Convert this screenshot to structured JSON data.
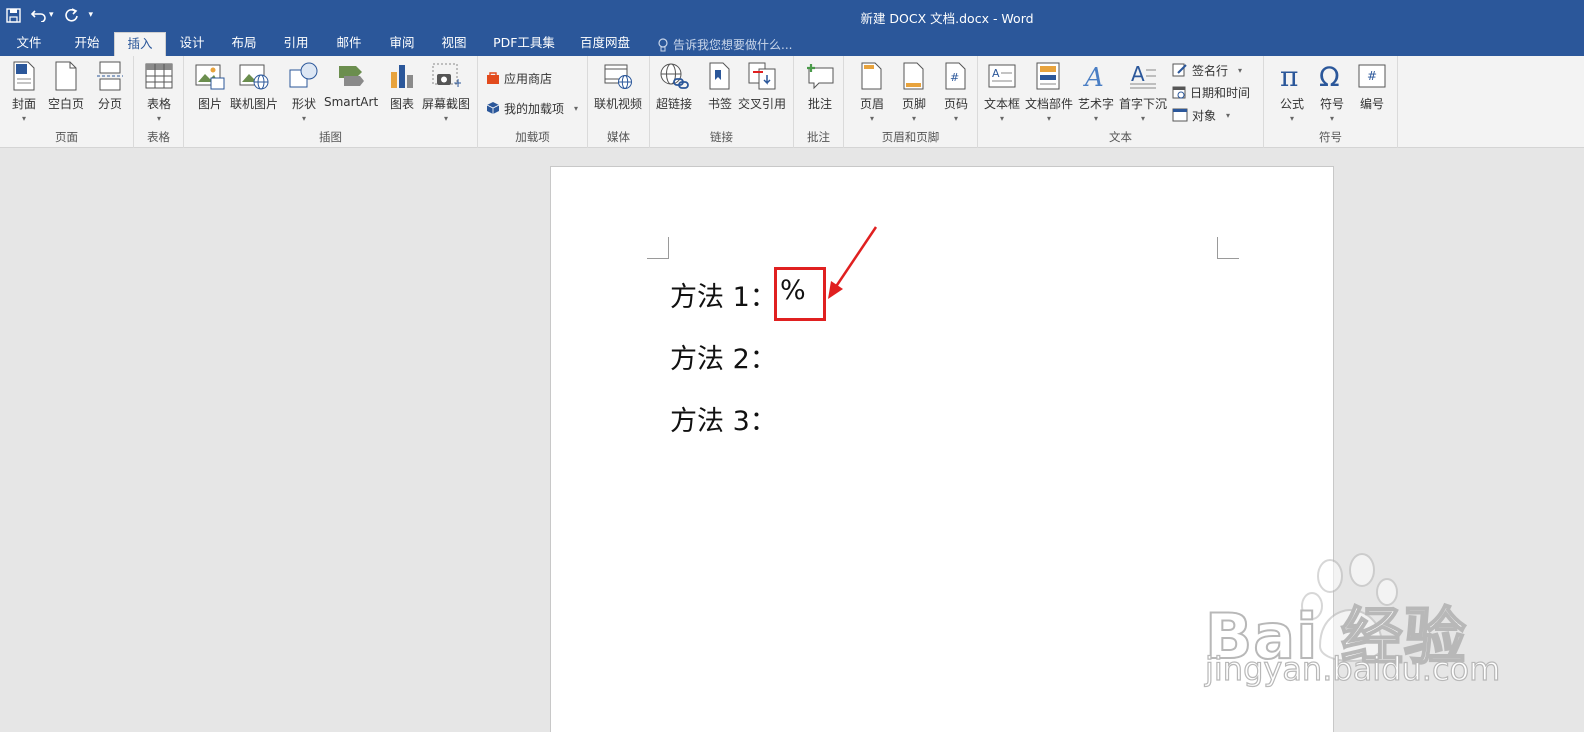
{
  "window": {
    "title": "新建 DOCX 文档.docx - Word"
  },
  "qat": {
    "undo_arrow": "▾",
    "customize": "▾"
  },
  "tabs": [
    {
      "label": "文件"
    },
    {
      "label": "开始"
    },
    {
      "label": "插入"
    },
    {
      "label": "设计"
    },
    {
      "label": "布局"
    },
    {
      "label": "引用"
    },
    {
      "label": "邮件"
    },
    {
      "label": "审阅"
    },
    {
      "label": "视图"
    },
    {
      "label": "PDF工具集"
    },
    {
      "label": "百度网盘"
    }
  ],
  "active_tab": "插入",
  "tellme": {
    "placeholder": "告诉我您想要做什么..."
  },
  "ribbon": {
    "page": {
      "label": "页面",
      "cover": "封面",
      "blank": "空白页",
      "break": "分页"
    },
    "table": {
      "label": "表格",
      "table": "表格"
    },
    "illustrations": {
      "label": "插图",
      "picture": "图片",
      "online_picture": "联机图片",
      "shapes": "形状",
      "smartart": "SmartArt",
      "chart": "图表",
      "screenshot": "屏幕截图"
    },
    "addins": {
      "label": "加载项",
      "store": "应用商店",
      "my_addins": "我的加载项"
    },
    "media": {
      "label": "媒体",
      "online_video": "联机视频"
    },
    "links": {
      "label": "链接",
      "hyperlink": "超链接",
      "bookmark": "书签",
      "cross_ref": "交叉引用"
    },
    "comments": {
      "label": "批注",
      "comment": "批注"
    },
    "header_footer": {
      "label": "页眉和页脚",
      "header": "页眉",
      "footer": "页脚",
      "page_number": "页码"
    },
    "text": {
      "label": "文本",
      "textbox": "文本框",
      "quick_parts": "文档部件",
      "wordart": "艺术字",
      "dropcap": "首字下沉",
      "signature": "签名行",
      "datetime": "日期和时间",
      "object": "对象"
    },
    "symbols": {
      "label": "符号",
      "equation": "公式",
      "symbol": "符号",
      "number": "编号"
    },
    "caret": "▾"
  },
  "document": {
    "lines": [
      "方法 1：",
      "方法 2：",
      "方法 3："
    ],
    "inserted_symbol": "%"
  },
  "watermark": {
    "brand": "Bai  经验",
    "url": "jingyan.baidu.com"
  },
  "colors": {
    "accent": "#2b579a",
    "highlight": "#e02020"
  }
}
